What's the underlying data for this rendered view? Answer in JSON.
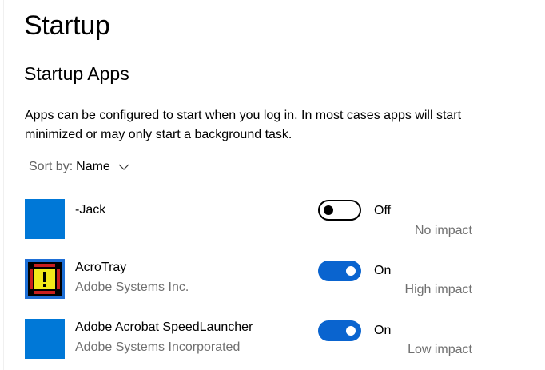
{
  "page": {
    "title": "Startup"
  },
  "section": {
    "title": "Startup Apps",
    "description": "Apps can be configured to start when you log in. In most cases apps will start minimized or may only start a background task."
  },
  "sort": {
    "label": "Sort by:",
    "value": "Name",
    "icon": "chevron-down-icon"
  },
  "apps": [
    {
      "name": "-Jack",
      "publisher": "",
      "enabled": false,
      "state_label": "Off",
      "impact": "No impact",
      "icon": "blank-app-icon"
    },
    {
      "name": "AcroTray",
      "publisher": "Adobe Systems Inc.",
      "enabled": true,
      "state_label": "On",
      "impact": "High impact",
      "icon": "acrotray-warning-icon"
    },
    {
      "name": "Adobe Acrobat SpeedLauncher",
      "publisher": "Adobe Systems Incorporated",
      "enabled": true,
      "state_label": "On",
      "impact": "Low impact",
      "icon": "blank-app-icon"
    }
  ],
  "colors": {
    "accent": "#0a64cf",
    "app_tile": "#0078d7",
    "secondary_text": "#707070"
  }
}
